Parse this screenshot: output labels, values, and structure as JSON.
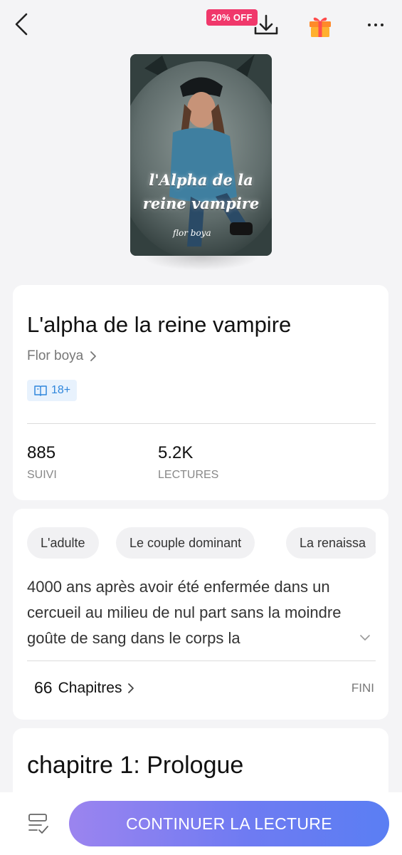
{
  "header": {
    "discount_badge": "20% OFF"
  },
  "cover": {
    "title_line1": "l'Alpha de la",
    "title_line2": "reine vampire",
    "author": "flor boya"
  },
  "book": {
    "title": "L'alpha de la reine vampire",
    "author": "Flor boya",
    "age_rating": "18+",
    "stats": [
      {
        "value": "885",
        "label": "SUIVI"
      },
      {
        "value": "5.2K",
        "label": "LECTURES"
      }
    ]
  },
  "tags": [
    "L'adulte",
    "Le couple dominant",
    "La renaissa"
  ],
  "synopsis": "4000 ans après avoir été enfermée dans un cercueil au milieu de nul part sans la moindre goûte de sang dans le corps la",
  "chapters": {
    "count": "66",
    "label": "Chapitres",
    "status": "FINI"
  },
  "first_chapter": {
    "title": "chapitre 1: Prologue"
  },
  "footer": {
    "continue_label": "CONTINUER LA LECTURE"
  },
  "colors": {
    "discount": "#f0386b",
    "tag_blue": "#2f86dc",
    "button_start": "#9b84ef",
    "button_end": "#5a7ef3"
  }
}
